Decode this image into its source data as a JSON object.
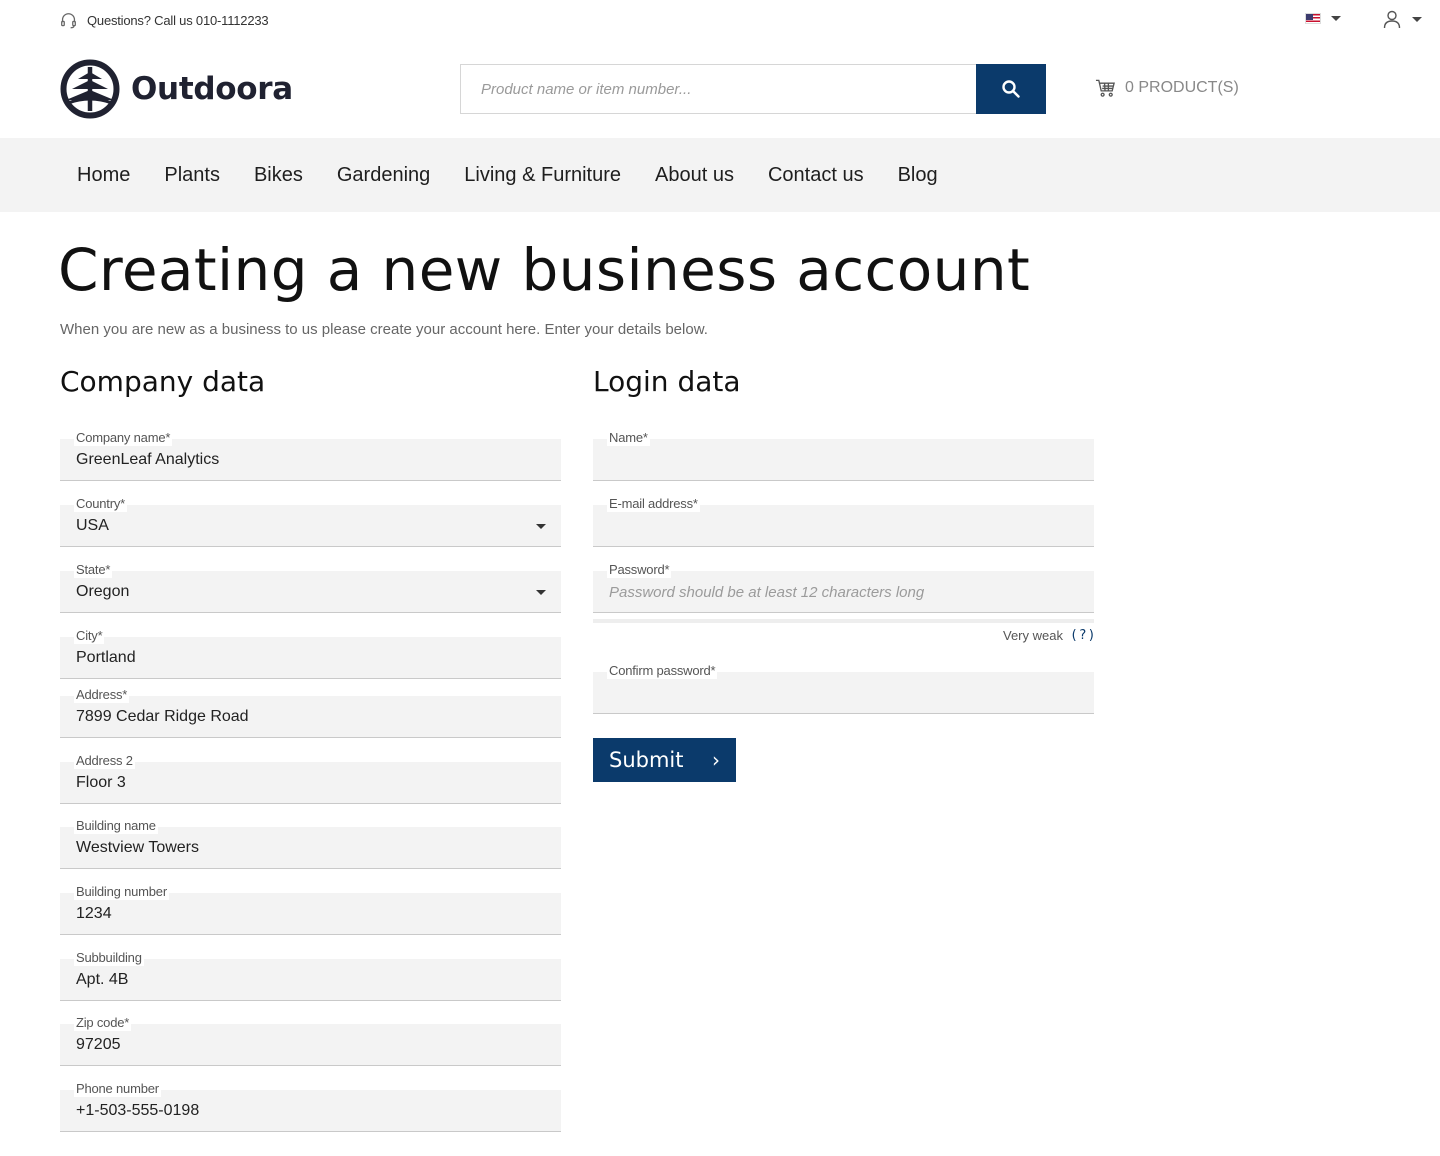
{
  "topbar": {
    "help_text": "Questions? Call us 010-1112233"
  },
  "header": {
    "brand": "Outdoora",
    "search_placeholder": "Product name or item number...",
    "cart_text": "0 PRODUCT(S)"
  },
  "nav": {
    "items": [
      "Home",
      "Plants",
      "Bikes",
      "Gardening",
      "Living & Furniture",
      "About us",
      "Contact us",
      "Blog"
    ]
  },
  "page": {
    "title": "Creating a new business account",
    "intro": "When you are new as a business to us please create your account here. Enter your details below."
  },
  "company": {
    "heading": "Company data",
    "company_name": {
      "label": "Company name*",
      "value": "GreenLeaf Analytics"
    },
    "country": {
      "label": "Country*",
      "value": "USA"
    },
    "state": {
      "label": "State*",
      "value": "Oregon"
    },
    "city": {
      "label": "City*",
      "value": "Portland"
    },
    "address": {
      "label": "Address*",
      "value": "7899 Cedar Ridge Road"
    },
    "address2": {
      "label": "Address 2",
      "value": "Floor 3"
    },
    "building_name": {
      "label": "Building name",
      "value": "Westview Towers"
    },
    "building_number": {
      "label": "Building number",
      "value": "1234"
    },
    "subbuilding": {
      "label": "Subbuilding",
      "value": "Apt. 4B"
    },
    "zip": {
      "label": "Zip code*",
      "value": "97205"
    },
    "phone": {
      "label": "Phone number",
      "value": "+1-503-555-0198"
    }
  },
  "login": {
    "heading": "Login data",
    "name": {
      "label": "Name*",
      "value": ""
    },
    "email": {
      "label": "E-mail address*",
      "value": ""
    },
    "password": {
      "label": "Password*",
      "placeholder": "Password should be at least 12 characters long"
    },
    "strength_text": "Very weak",
    "strength_help": "(?)",
    "confirm": {
      "label": "Confirm password*",
      "value": ""
    }
  },
  "submit_label": "Submit",
  "colors": {
    "primary": "#0b3a6b",
    "field_bg": "#f3f3f3",
    "nav_bg": "#f3f3f3"
  }
}
